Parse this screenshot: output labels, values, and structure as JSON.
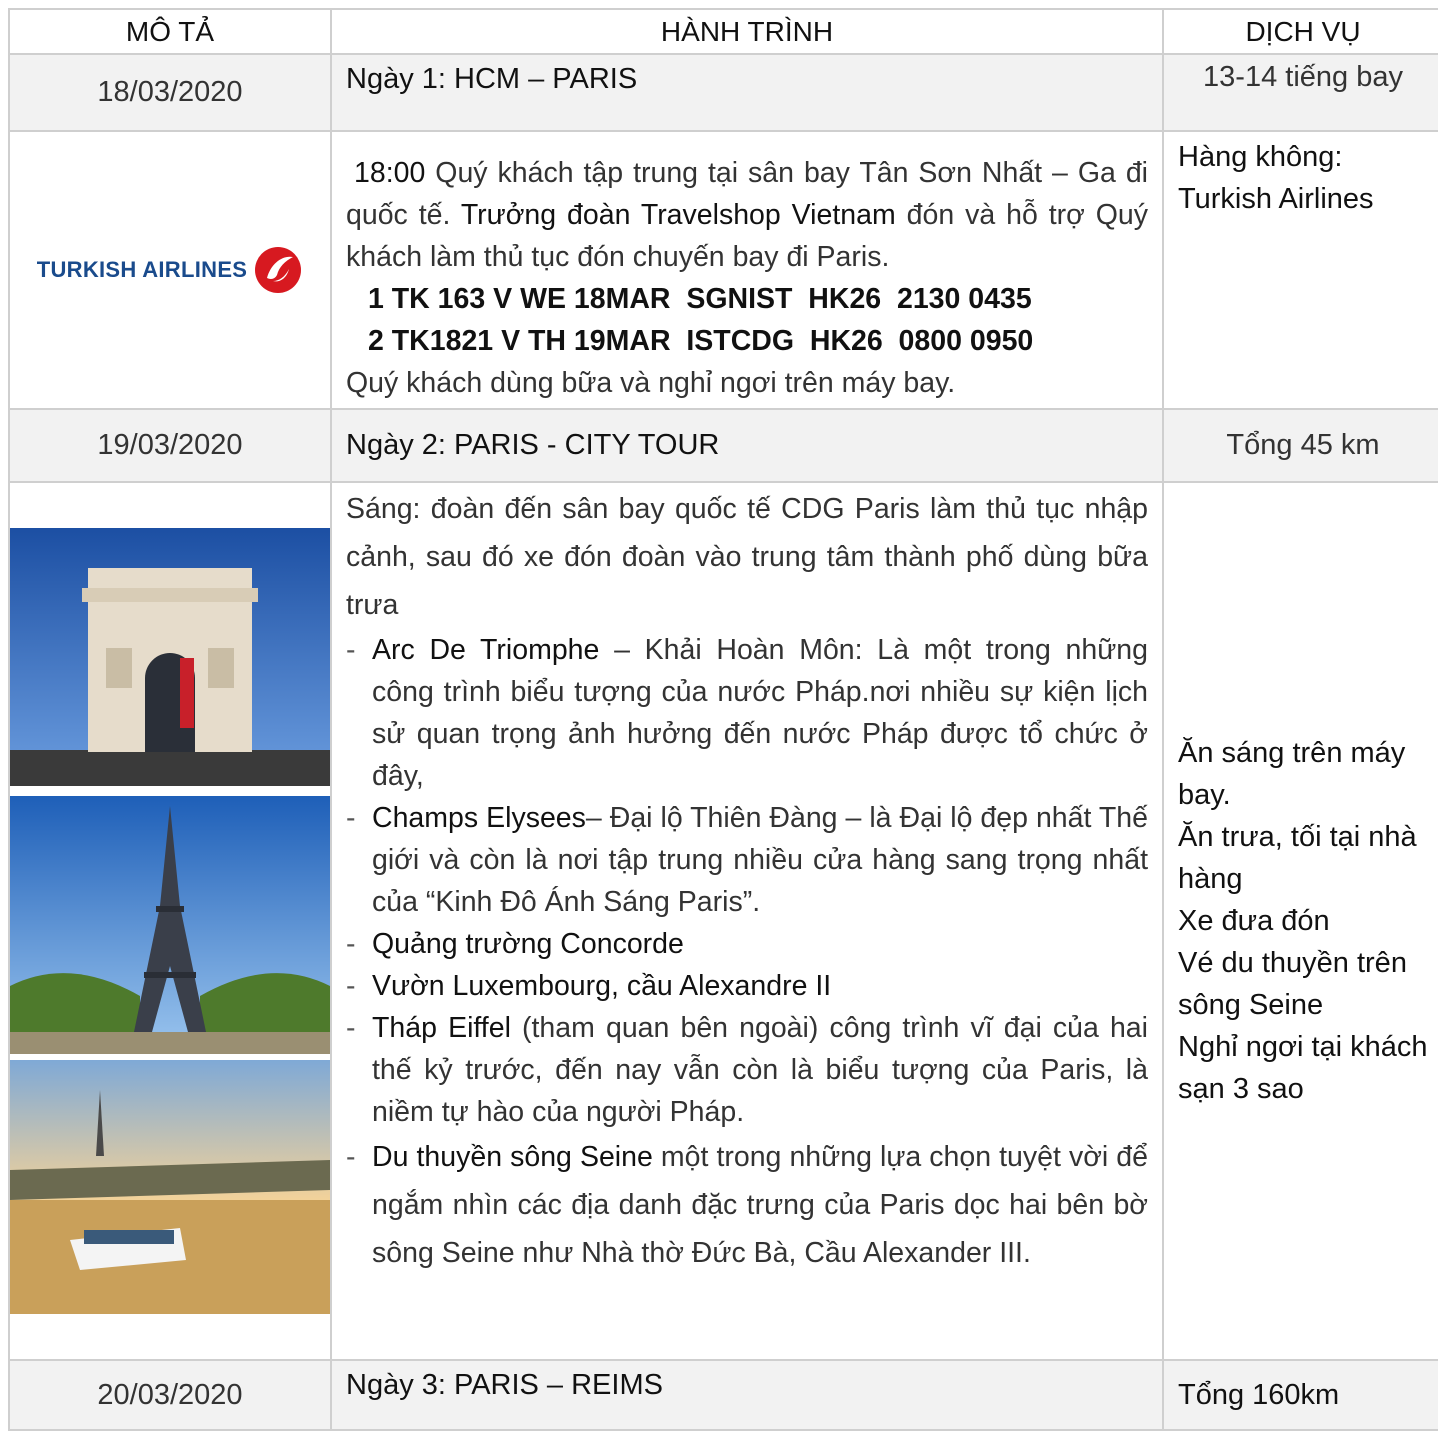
{
  "header": {
    "col1": "MÔ TẢ",
    "col2": "HÀNH TRÌNH",
    "col3": "DỊCH VỤ"
  },
  "day1": {
    "date": "18/03/2020",
    "title": "Ngày 1: HCM – PARIS",
    "service_time": "13-14 tiếng bay",
    "logo_text": "TURKISH AIRLINES",
    "time": "18:00",
    "text_a": " Quý khách tập trung tại sân bay Tân Sơn Nhất – Ga đi quốc tế. ",
    "leader": "Trưởng đoàn Travelshop Vietnam",
    "text_b": "  đón và hỗ trợ Quý khách làm thủ tục đón chuyến bay đi Paris.",
    "flight1": "1 TK 163 V WE 18MAR  SGNIST  HK26  2130 0435",
    "flight2": "2 TK1821 V TH 19MAR  ISTCDG  HK26  0800 0950",
    "closing": "Quý khách dùng bữa và nghỉ ngơi trên máy bay.",
    "service_line1": "Hàng không:",
    "service_line2": "Turkish Airlines"
  },
  "day2": {
    "date": "19/03/2020",
    "title": "Ngày 2: PARIS - CITY TOUR",
    "distance": "Tổng 45 km",
    "intro": "Sáng: đoàn đến sân bay quốc tế CDG Paris làm thủ tục nhập cảnh, sau đó xe đón đoàn vào trung tâm thành phố dùng bữa trưa",
    "items": [
      {
        "name": "Arc De Triomphe",
        "desc": " – Khải Hoàn Môn: Là một trong những công trình biểu tượng của nước Pháp.nơi nhiều sự kiện lịch sử quan trọng ảnh hưởng đến nước Pháp được tổ chức ở đây,"
      },
      {
        "name": "Champs Elysees",
        "desc": "– Đại lộ Thiên Đàng – là Đại lộ đẹp nhất Thế giới và còn là nơi tập trung nhiều cửa hàng sang trọng nhất của “Kinh Đô Ánh Sáng Paris”."
      },
      {
        "name": "Quảng trường Concorde",
        "desc": ""
      },
      {
        "name": "Vườn Luxembourg, cầu Alexandre II",
        "desc": ""
      },
      {
        "name": "Tháp Eiffel",
        "desc": " (tham quan bên ngoài) công trình vĩ đại của hai thế kỷ trước, đến nay vẫn còn là biểu tượng của Paris, là niềm tự hào của người Pháp."
      },
      {
        "name": "Du thuyền sông Seine",
        "desc": " một trong những lựa chọn tuyệt vời để ngắm nhìn các địa danh đặc trưng của Paris dọc hai bên bờ sông Seine như Nhà thờ Đức Bà, Cầu Alexander III."
      }
    ],
    "services": [
      "Ăn sáng trên máy bay.",
      "Ăn trưa, tối tại nhà hàng",
      "Xe đưa đón",
      "Vé du thuyền trên sông Seine",
      "Nghỉ ngơi tại khách sạn 3 sao"
    ]
  },
  "day3": {
    "date": "20/03/2020",
    "title": "Ngày 3: PARIS – REIMS",
    "distance": "Tổng 160km"
  }
}
